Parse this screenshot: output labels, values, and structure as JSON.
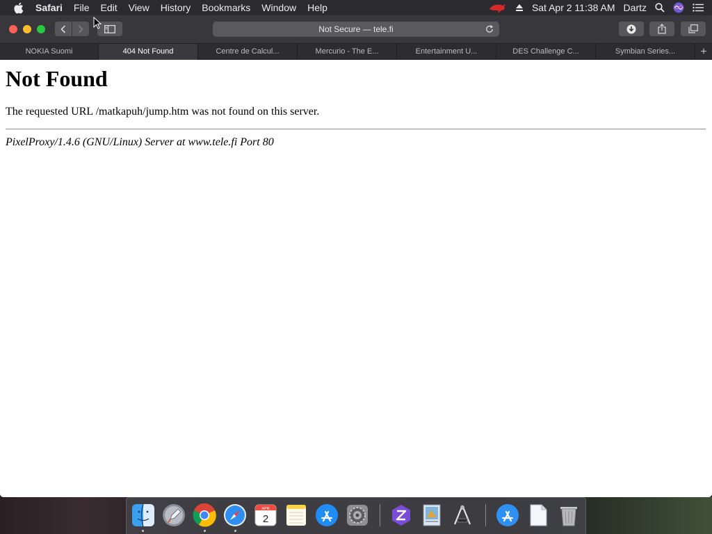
{
  "menubar": {
    "app_name": "Safari",
    "items": [
      "File",
      "Edit",
      "View",
      "History",
      "Bookmarks",
      "Window",
      "Help"
    ],
    "clock": "Sat Apr 2  11:38 AM",
    "user": "Dartz"
  },
  "toolbar": {
    "address": "Not Secure — tele.fi"
  },
  "tabs": [
    {
      "label": "NOKIA Suomi"
    },
    {
      "label": "404 Not Found"
    },
    {
      "label": "Centre de Calcul..."
    },
    {
      "label": "Mercurio - The E..."
    },
    {
      "label": "Entertainment U..."
    },
    {
      "label": "DES Challenge C..."
    },
    {
      "label": "Symbian Series..."
    }
  ],
  "new_tab_label": "+",
  "page": {
    "heading": "Not Found",
    "message": "The requested URL /matkapuh/jump.htm was not found on this server.",
    "server_signature": "PixelProxy/1.4.6 (GNU/Linux) Server at www.tele.fi Port 80"
  },
  "dock": {
    "calendar_month": "APR",
    "calendar_day": "2",
    "icons": [
      "finder-icon",
      "launchpad-icon",
      "chrome-icon",
      "safari-icon",
      "calendar-icon",
      "notes-icon",
      "app-store-icon",
      "system-preferences-icon",
      "zed-icon",
      "preview-icon",
      "xcode-instruments-icon",
      "app-store-downloads-icon",
      "document-icon",
      "trash-icon"
    ]
  },
  "colors": {
    "close": "#fe5f57",
    "minimize": "#febc2e",
    "zoom": "#28c840",
    "menubar_bg": "#2b2a2e",
    "toolbar_bg": "#38373b"
  }
}
